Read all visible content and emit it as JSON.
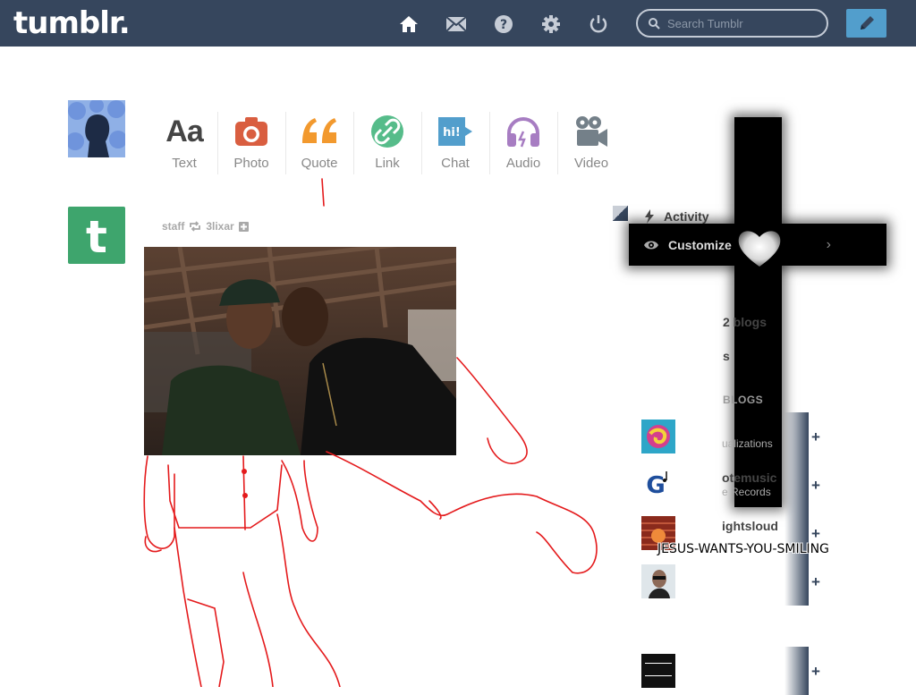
{
  "topbar": {
    "logo": "tumblr.",
    "search_placeholder": "Search Tumblr",
    "icons": [
      "home-icon",
      "mail-icon",
      "help-icon",
      "gear-icon",
      "power-icon"
    ]
  },
  "post_types": [
    {
      "label": "Text",
      "color": "#444444"
    },
    {
      "label": "Photo",
      "color": "#d95e40"
    },
    {
      "label": "Quote",
      "color": "#f2992e"
    },
    {
      "label": "Link",
      "color": "#56bc8a"
    },
    {
      "label": "Chat",
      "color": "#529ecc"
    },
    {
      "label": "Audio",
      "color": "#a77dc2"
    },
    {
      "label": "Video",
      "color": "#748089"
    }
  ],
  "post": {
    "author": "staff",
    "reblogged_from": "3lixar"
  },
  "sidebar": {
    "activity": "Activity",
    "customize": "Customize",
    "blogs_count": "2 blogs",
    "likes": "s",
    "recommended_header": "BLOGS",
    "recommended": [
      {
        "name": "",
        "sub": "ualizations"
      },
      {
        "name": "otemusic",
        "sub": "e Records"
      },
      {
        "name": "ightsloud",
        "sub": ""
      },
      {
        "name": "",
        "sub": ""
      },
      {
        "name": "",
        "sub": ""
      }
    ]
  },
  "overlay_text": "JESUS-WANTS-YOU-SMILING",
  "colors": {
    "topbar": "#36465d",
    "compose": "#529ecc"
  }
}
